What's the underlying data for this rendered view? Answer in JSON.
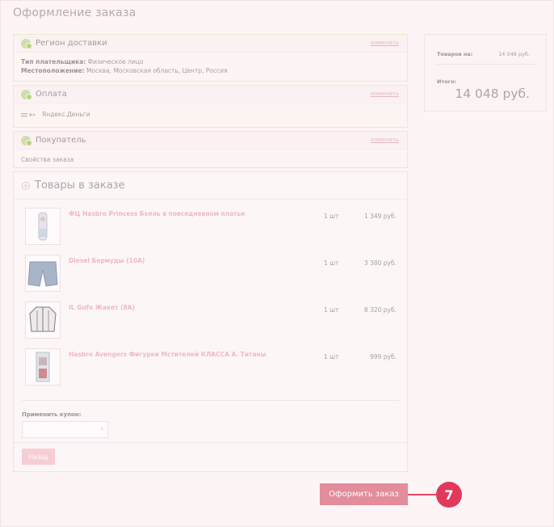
{
  "page": {
    "title": "Оформление заказа"
  },
  "sections": {
    "region": {
      "title": "Регион доставки",
      "change": "изменить",
      "payer_type_label": "Тип плательщика:",
      "payer_type_value": "Физическое лицо",
      "location_label": "Местоположение:",
      "location_value": "Москва, Московская область, Центр, Россия"
    },
    "payment": {
      "title": "Оплата",
      "change": "изменить",
      "method": "Яндекс.Деньги"
    },
    "buyer": {
      "title": "Покупатель",
      "change": "изменить",
      "properties": "Свойства заказа"
    }
  },
  "cart": {
    "title": "Товары в заказе",
    "items": [
      {
        "name": "ФЦ Hasbro Princess Бэлль в повседневном платье",
        "qty": "1 шт",
        "price": "1 349 руб."
      },
      {
        "name": "Diesel Бермуды (10A)",
        "qty": "1 шт",
        "price": "3 380 руб."
      },
      {
        "name": "IL Gufo Жакет (8A)",
        "qty": "1 шт",
        "price": "8 320 руб."
      },
      {
        "name": "Hasbro Avengers Фигурки Мстителей КЛАССА А. Титаны",
        "qty": "1 шт",
        "price": "999 руб."
      }
    ],
    "coupon_label": "Применить купон:",
    "coupon_value": "",
    "back": "Назад"
  },
  "summary": {
    "goods_label": "Товаров на:",
    "goods_value": "14 048 руб.",
    "total_label": "Итого:",
    "total_value": "14 048 руб."
  },
  "actions": {
    "checkout": "Оформить заказ"
  },
  "annotation": {
    "step": "7"
  },
  "colors": {
    "accent": "#e28c9c",
    "badge": "#e0395c",
    "link": "#e6b8c2"
  }
}
